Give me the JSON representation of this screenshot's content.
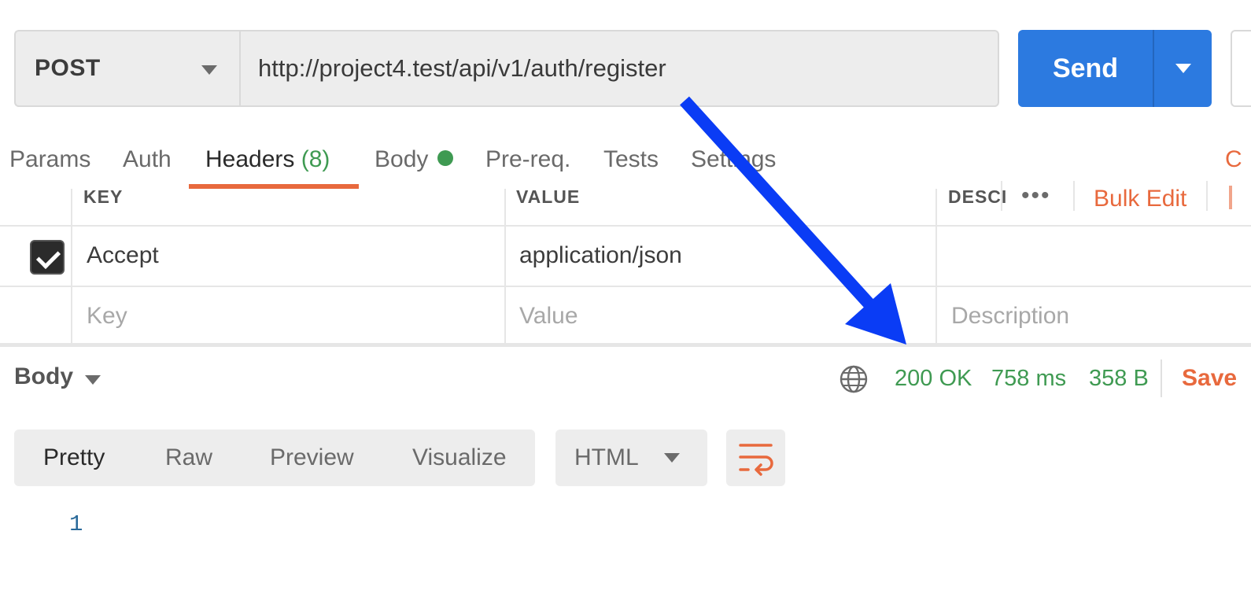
{
  "request": {
    "method": "POST",
    "url": "http://project4.test/api/v1/auth/register",
    "send_label": "Send"
  },
  "tabs": [
    {
      "label": "Params"
    },
    {
      "label": "Auth"
    },
    {
      "label": "Headers",
      "count": "(8)",
      "active": true
    },
    {
      "label": "Body",
      "indicator": "green-dot"
    },
    {
      "label": "Pre-req."
    },
    {
      "label": "Tests"
    },
    {
      "label": "Settings"
    }
  ],
  "headers_table": {
    "columns": {
      "key": "KEY",
      "value": "VALUE",
      "description": "DESCI"
    },
    "more_label": "•••",
    "bulk_edit_label": "Bulk Edit",
    "rows": [
      {
        "checked": true,
        "key": "Accept",
        "value": "application/json",
        "description": ""
      }
    ],
    "placeholders": {
      "key": "Key",
      "value": "Value",
      "description": "Description"
    }
  },
  "response": {
    "body_label": "Body",
    "status": "200 OK",
    "time": "758 ms",
    "size": "358 B",
    "save_label": "Save",
    "view_modes": [
      "Pretty",
      "Raw",
      "Preview",
      "Visualize"
    ],
    "active_view": "Pretty",
    "format": "HTML",
    "line_numbers": [
      "1"
    ]
  },
  "colors": {
    "accent": "#e8693d",
    "send_blue": "#2c7ae0",
    "status_green": "#3f9a52",
    "annotation_arrow": "#0a3cf5"
  },
  "icons": {
    "method_dropdown": "chevron-down-icon",
    "send_dropdown": "chevron-down-icon",
    "network": "globe-icon",
    "wrap": "wrap-lines-icon",
    "checkbox": "checkmark-icon"
  }
}
